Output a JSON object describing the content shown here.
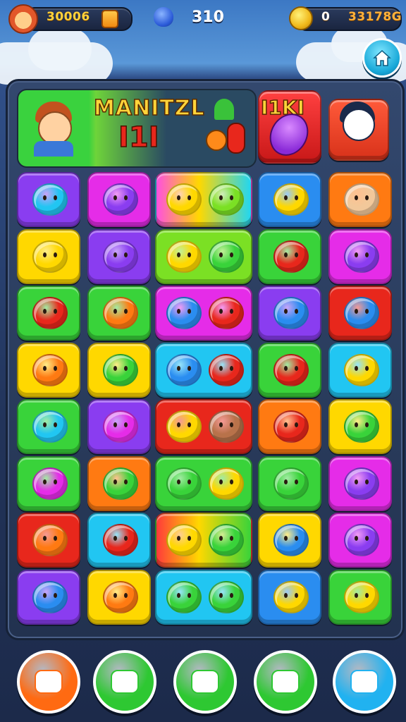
{
  "hud": {
    "score": "30006",
    "center_value": "310",
    "coins": "0",
    "total": "33178G"
  },
  "banner": {
    "title_left": "MANITZL",
    "title_mid": "I1I",
    "title_right": "I1KI"
  },
  "colors": {
    "green": "#39d33a",
    "lime": "#7be024",
    "yellow": "#ffd800",
    "orange": "#ff7a12",
    "red": "#e8271c",
    "purple": "#8a3df0",
    "magenta": "#e52ce8",
    "blue": "#2a8df0",
    "cyan": "#21c6f2"
  },
  "grid": [
    [
      {
        "bg": "purple",
        "items": [
          {
            "col": "cyan"
          }
        ]
      },
      {
        "bg": "magenta",
        "items": [
          {
            "col": "purple"
          }
        ]
      },
      {
        "bg": "rainbow1",
        "wide": true,
        "items": [
          {
            "col": "yellow"
          },
          {
            "col": "lime"
          }
        ]
      },
      {
        "bg": "blue",
        "items": [
          {
            "col": "yellow"
          }
        ]
      },
      {
        "bg": "orange",
        "items": [
          {
            "col": "beige"
          }
        ]
      }
    ],
    [
      {
        "bg": "yellow",
        "items": [
          {
            "col": "yellow"
          }
        ]
      },
      {
        "bg": "purple",
        "items": [
          {
            "col": "purple"
          }
        ]
      },
      {
        "bg": "lime",
        "wide": true,
        "items": [
          {
            "col": "yellow"
          },
          {
            "col": "green"
          }
        ]
      },
      {
        "bg": "green",
        "items": [
          {
            "col": "red"
          }
        ]
      },
      {
        "bg": "magenta",
        "items": [
          {
            "col": "purple"
          }
        ]
      }
    ],
    [
      {
        "bg": "green",
        "items": [
          {
            "col": "red"
          }
        ]
      },
      {
        "bg": "green",
        "items": [
          {
            "col": "orange"
          }
        ]
      },
      {
        "bg": "magenta",
        "wide": true,
        "items": [
          {
            "col": "blue"
          },
          {
            "col": "red"
          }
        ]
      },
      {
        "bg": "purple",
        "items": [
          {
            "col": "blue"
          }
        ]
      },
      {
        "bg": "red",
        "items": [
          {
            "col": "blue"
          }
        ]
      }
    ],
    [
      {
        "bg": "yellow",
        "items": [
          {
            "col": "orange"
          }
        ]
      },
      {
        "bg": "yellow",
        "items": [
          {
            "col": "green"
          }
        ]
      },
      {
        "bg": "cyan",
        "wide": true,
        "items": [
          {
            "col": "blue"
          },
          {
            "col": "red"
          }
        ]
      },
      {
        "bg": "green",
        "items": [
          {
            "col": "red"
          }
        ]
      },
      {
        "bg": "cyan",
        "items": [
          {
            "col": "yellow"
          }
        ]
      }
    ],
    [
      {
        "bg": "green",
        "items": [
          {
            "col": "cyan"
          }
        ]
      },
      {
        "bg": "purple",
        "items": [
          {
            "col": "magenta"
          }
        ]
      },
      {
        "bg": "red",
        "wide": true,
        "items": [
          {
            "col": "yellow"
          },
          {
            "col": "brown"
          }
        ]
      },
      {
        "bg": "orange",
        "items": [
          {
            "col": "red"
          }
        ]
      },
      {
        "bg": "yellow",
        "items": [
          {
            "col": "green"
          }
        ]
      }
    ],
    [
      {
        "bg": "green",
        "items": [
          {
            "col": "magenta"
          }
        ]
      },
      {
        "bg": "orange",
        "items": [
          {
            "col": "green"
          }
        ]
      },
      {
        "bg": "green",
        "wide": true,
        "items": [
          {
            "col": "green"
          },
          {
            "col": "yellow"
          }
        ]
      },
      {
        "bg": "green",
        "items": [
          {
            "col": "green"
          }
        ]
      },
      {
        "bg": "magenta",
        "items": [
          {
            "col": "purple"
          }
        ]
      }
    ],
    [
      {
        "bg": "red",
        "items": [
          {
            "col": "orange"
          }
        ]
      },
      {
        "bg": "cyan",
        "items": [
          {
            "col": "red"
          }
        ]
      },
      {
        "bg": "rainbow2",
        "wide": true,
        "items": [
          {
            "col": "yellow"
          },
          {
            "col": "green"
          }
        ]
      },
      {
        "bg": "yellow",
        "items": [
          {
            "col": "blue"
          }
        ]
      },
      {
        "bg": "magenta",
        "items": [
          {
            "col": "purple"
          }
        ]
      }
    ],
    [
      {
        "bg": "purple",
        "items": [
          {
            "col": "blue"
          }
        ]
      },
      {
        "bg": "yellow",
        "items": [
          {
            "col": "orange"
          }
        ]
      },
      {
        "bg": "cyan",
        "wide": true,
        "items": [
          {
            "col": "green"
          },
          {
            "col": "green"
          }
        ]
      },
      {
        "bg": "blue",
        "items": [
          {
            "col": "yellow"
          }
        ]
      },
      {
        "bg": "green",
        "items": [
          {
            "col": "yellow"
          }
        ]
      }
    ]
  ],
  "bottom_buttons": [
    {
      "name": "tool-button",
      "color": "#ff6a12",
      "icon": "flag-icon"
    },
    {
      "name": "shuffle-button",
      "color": "#2ec832",
      "icon": "star-icon"
    },
    {
      "name": "hint-button",
      "color": "#2ec832",
      "icon": "heart-icon"
    },
    {
      "name": "chat-button",
      "color": "#2ec832",
      "icon": "message-icon"
    },
    {
      "name": "boost-button",
      "color": "#21b2f0",
      "icon": "puzzle-icon"
    }
  ]
}
